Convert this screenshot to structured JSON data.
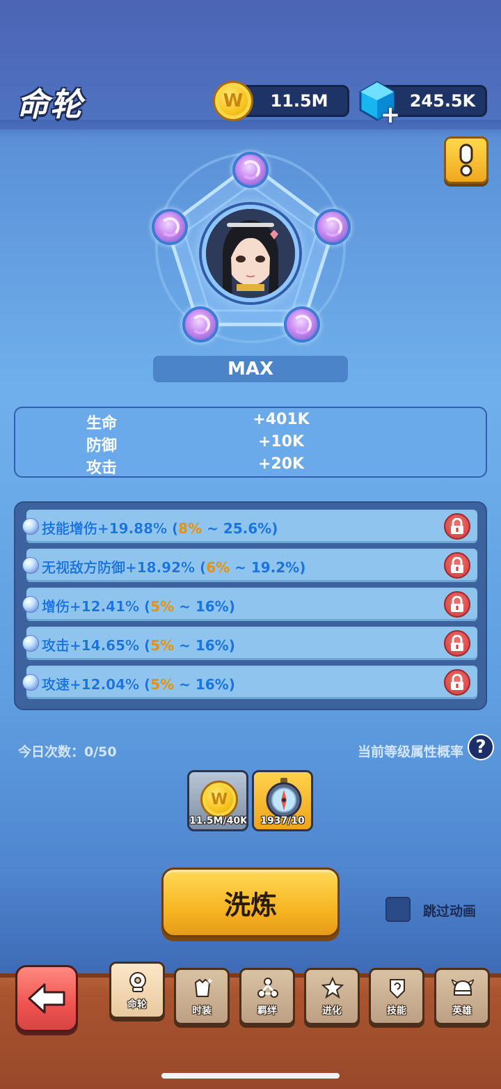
{
  "header": {
    "title": "命轮",
    "gold": "11.5M",
    "gems": "245.5K"
  },
  "wheel": {
    "level_label": "MAX"
  },
  "stats": [
    {
      "name": "生命",
      "value": "+401K"
    },
    {
      "name": "防御",
      "value": "+10K"
    },
    {
      "name": "攻击",
      "value": "+20K"
    }
  ],
  "attributes": [
    {
      "text": "技能增伤+19.88% (",
      "min": "8%",
      "rest": " ~ 25.6%)"
    },
    {
      "text": "无视敌方防御+18.92% (",
      "min": "6%",
      "rest": " ~ 19.2%)"
    },
    {
      "text": "增伤+12.41% (",
      "min": "5%",
      "rest": " ~ 16%)"
    },
    {
      "text": "攻击+14.65% (",
      "min": "5%",
      "rest": " ~ 16%)"
    },
    {
      "text": "攻速+12.04% (",
      "min": "5%",
      "rest": " ~ 16%)"
    }
  ],
  "controls": {
    "today_count": "今日次数：0/50",
    "probability_label": "当前等级属性概率",
    "help": "?",
    "cost_gold": "11.5M/40K",
    "cost_compass": "1937/10",
    "refine_label": "洗炼",
    "skip_label": "跳过动画"
  },
  "nav": {
    "tabs": [
      {
        "label": "命轮",
        "icon": "wheel-icon"
      },
      {
        "label": "时装",
        "icon": "costume-icon"
      },
      {
        "label": "羁绊",
        "icon": "bond-icon"
      },
      {
        "label": "进化",
        "icon": "evolve-icon"
      },
      {
        "label": "技能",
        "icon": "skill-icon"
      },
      {
        "label": "英雄",
        "icon": "hero-icon"
      }
    ]
  },
  "colors": {
    "accent_gold": "#f7b623",
    "lock_red": "#d23b3b",
    "range_orange": "#e9900f"
  }
}
